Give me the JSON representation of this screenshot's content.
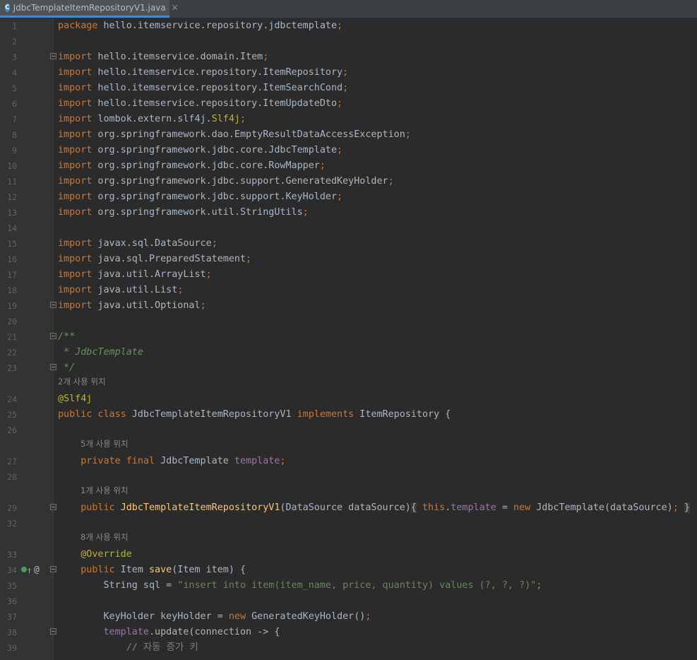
{
  "tab": {
    "title": "JdbcTemplateItemRepositoryV1.java",
    "icon": "C",
    "close": "✕"
  },
  "usage_hints": {
    "h1": "2개 사용 위치",
    "h2": "5개 사용 위치",
    "h3": "1개 사용 위치",
    "h4": "8개 사용 위치"
  },
  "lines": {
    "l1": {
      "n": "1",
      "t": "package hello.itemservice.repository.jdbctemplate;"
    },
    "l2": {
      "n": "2"
    },
    "l3": {
      "n": "3",
      "t": "import hello.itemservice.domain.Item;"
    },
    "l4": {
      "n": "4",
      "t": "import hello.itemservice.repository.ItemRepository;"
    },
    "l5": {
      "n": "5",
      "t": "import hello.itemservice.repository.ItemSearchCond;"
    },
    "l6": {
      "n": "6",
      "t": "import hello.itemservice.repository.ItemUpdateDto;"
    },
    "l7": {
      "n": "7",
      "t": "import lombok.extern.slf4j.Slf4j;"
    },
    "l8": {
      "n": "8",
      "t": "import org.springframework.dao.EmptyResultDataAccessException;"
    },
    "l9": {
      "n": "9",
      "t": "import org.springframework.jdbc.core.JdbcTemplate;"
    },
    "l10": {
      "n": "10",
      "t": "import org.springframework.jdbc.core.RowMapper;"
    },
    "l11": {
      "n": "11",
      "t": "import org.springframework.jdbc.support.GeneratedKeyHolder;"
    },
    "l12": {
      "n": "12",
      "t": "import org.springframework.jdbc.support.KeyHolder;"
    },
    "l13": {
      "n": "13",
      "t": "import org.springframework.util.StringUtils;"
    },
    "l14": {
      "n": "14"
    },
    "l15": {
      "n": "15",
      "t": "import javax.sql.DataSource;"
    },
    "l16": {
      "n": "16",
      "t": "import java.sql.PreparedStatement;"
    },
    "l17": {
      "n": "17",
      "t": "import java.util.ArrayList;"
    },
    "l18": {
      "n": "18",
      "t": "import java.util.List;"
    },
    "l19": {
      "n": "19",
      "t": "import java.util.Optional;"
    },
    "l20": {
      "n": "20"
    },
    "l21": {
      "n": "21",
      "t": "/**"
    },
    "l22": {
      "n": "22",
      "t": " * JdbcTemplate"
    },
    "l23": {
      "n": "23",
      "t": " */"
    },
    "l24": {
      "n": "24",
      "t": "@Slf4j"
    },
    "l25": {
      "n": "25",
      "t": "public class JdbcTemplateItemRepositoryV1 implements ItemRepository {"
    },
    "l26": {
      "n": "26"
    },
    "l27": {
      "n": "27",
      "t": "    private final JdbcTemplate template;"
    },
    "l28": {
      "n": "28"
    },
    "l29": {
      "n": "29",
      "t": "    public JdbcTemplateItemRepositoryV1(DataSource dataSource) { this.template = new JdbcTemplate(dataSource); }"
    },
    "l32": {
      "n": "32"
    },
    "l33": {
      "n": "33",
      "t": "    @Override"
    },
    "l34": {
      "n": "34",
      "t": "    public Item save(Item item) {"
    },
    "l35": {
      "n": "35",
      "t": "        String sql = \"insert into item(item_name, price, quantity) values (?, ?, ?)\";"
    },
    "l36": {
      "n": "36"
    },
    "l37": {
      "n": "37",
      "t": "        KeyHolder keyHolder = new GeneratedKeyHolder();"
    },
    "l38": {
      "n": "38",
      "t": "        template.update(connection -> {"
    },
    "l39": {
      "n": "39",
      "t": "            // 자동 증가 키"
    }
  },
  "colors": {
    "background": "#2b2b2b",
    "keyword": "#cc7832",
    "string": "#6a8759",
    "annotation": "#bbb529",
    "field": "#9876aa",
    "method_declaration": "#ffc66d",
    "doc_comment": "#629755",
    "line_comment": "#808080"
  },
  "gutter_icons": [
    "run-icon",
    "implements-up-arrow-icon",
    "at-annotation-icon"
  ]
}
